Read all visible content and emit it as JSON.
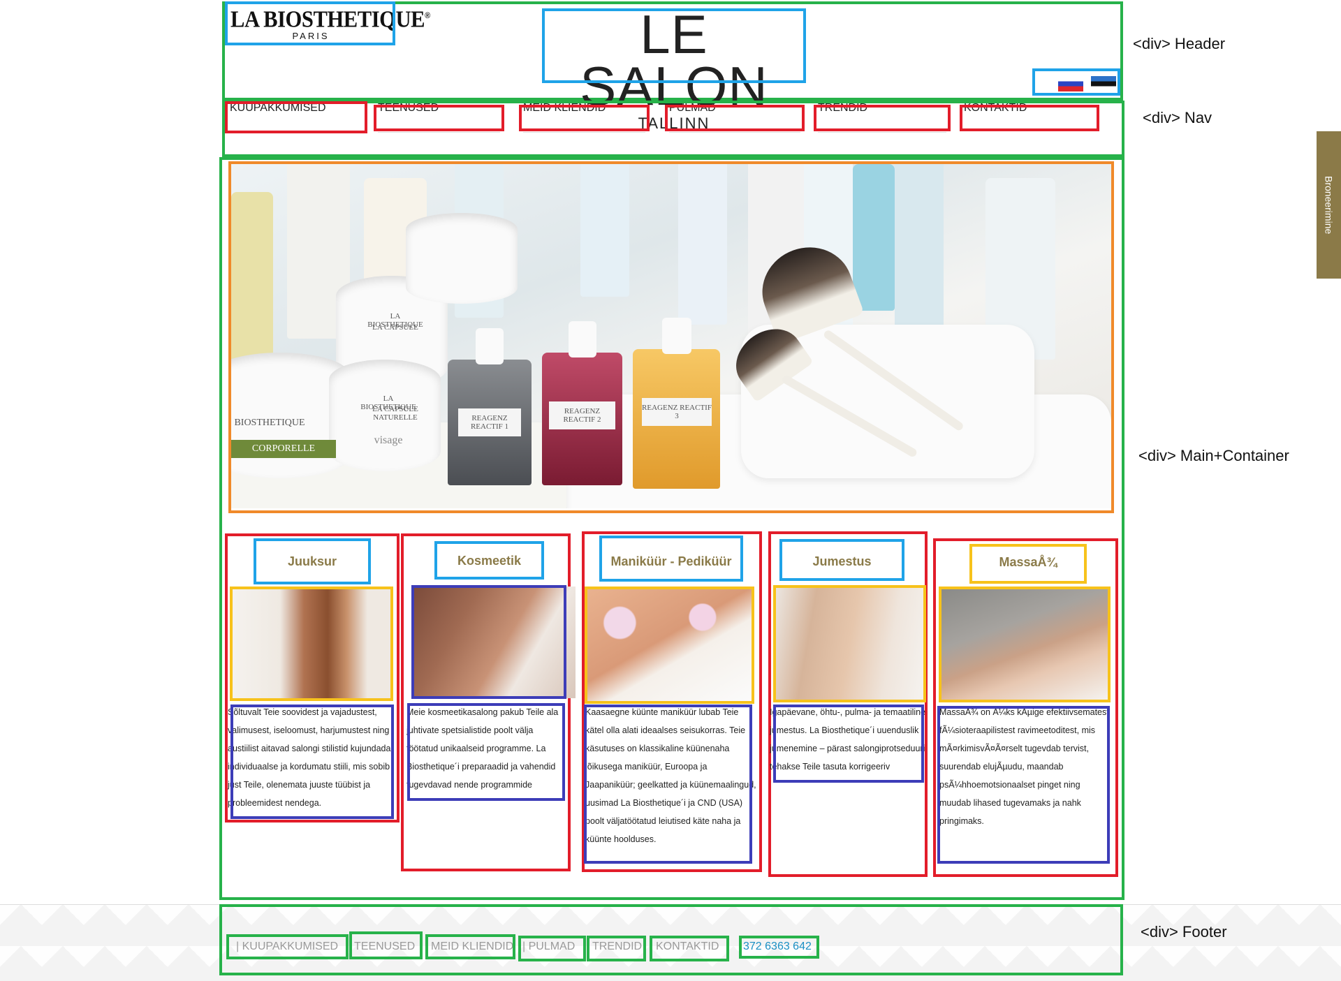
{
  "header": {
    "brand_logo": {
      "name": "LA BIOSTHETIQUE",
      "registered": "®",
      "city": "PARIS"
    },
    "salon_logo": {
      "title": "LE SALON",
      "city": "TALLINN"
    },
    "flags": [
      "russian-flag-icon",
      "estonian-flag-icon"
    ]
  },
  "nav": {
    "items": [
      "KUUPAKKUMISED",
      "TEENUSED",
      "MEID KLIENDID",
      "PULMAD",
      "TRENDID",
      "KONTAKTID"
    ]
  },
  "booking_tab": {
    "label": "Broneerimine"
  },
  "hero": {
    "jar_labels": [
      "LA BIOSTHETIQUE",
      "LA CAPSULE",
      "LA BIOSTHETIQUE",
      "LA CAPSULE NATURELLE",
      "visage",
      "BIOSTHETIQUE",
      "CORPORELLE"
    ],
    "bottle_labels": [
      "REAGENZ REACTIF 1",
      "REAGENZ REACTIF 2",
      "REAGENZ REACTIF 3"
    ]
  },
  "services": [
    {
      "title": "Juuksur",
      "text": "Sõltuvalt Teie soovidest ja vajadustest, valimusest, iseloomust, harjumustest ning austiilist aitavad salongi stilistid kujundada individuaalse ja kordumatu stiili, mis sobib just Teile, olenemata juuste tüübist ja probleemidest nendega."
    },
    {
      "title": "Kosmeetik",
      "text": "Meie kosmeetikasalong pakub Teile ala juhtivate spetsialistide poolt välja töötatud unikaalseid programme. La Biosthetique´i preparaadid ja vahendid tugevdavad nende programmide efektiivsust veelgi."
    },
    {
      "title": "Maniküür - Pediküür",
      "text": "Kaasaegne küünte maniküür lubab Teie kätel olla alati ideaalses seisukorras. Teie käsutuses on klassikaline küünenaha lõikusega maniküür, Euroopa ja Jaapaniküür; geelkatted ja küünemaalingud, uusimad La Biosthetique´i ja CND (USA) poolt väljatöötatud leiutised käte naha ja küünte hoolduses."
    },
    {
      "title": "Jumestus",
      "text": "Igapäevane, öhtu-, pulma- ja temaatiline jumestus. La Biosthetique´i uuenduslik jumenemine – pärast salongiprotseduuri tehakse Teile tasuta korrigeeriv jumestus."
    },
    {
      "title": "MassaÅ¾",
      "text": "MassaÅ¾ on Ã¼ks kÃµige efektiivsematest fÃ¼sioteraapilistest ravimeetoditest, mis mÃ¤rkimisvÃ¤Ã¤rselt tugevdab tervist, suurendab elujÃµudu, maandab psÃ¼hhoemotsionaalset pinget ning muudab lihased tugevamaks ja nahk pringimaks."
    }
  ],
  "footer": {
    "links": [
      "| KUUPAKKUMISED",
      "TEENUSED",
      "MEID KLIENDID",
      "| PULMAD",
      "TRENDID",
      "KONTAKTID"
    ],
    "phone": "372 6363 642"
  },
  "annotations": {
    "header": "<div> Header",
    "nav": "<div> Nav",
    "main": "<div> Main+Container",
    "footer": "<div> Footer"
  },
  "colors": {
    "accent_gold": "#8b7a48",
    "service_title": "#8a7a48",
    "link_gray": "#9a9a9a",
    "phone_blue": "#1a8fc4",
    "box_green": "#27b24a",
    "box_blue": "#1fa3e8",
    "box_red": "#e21d2a",
    "box_orange": "#f08a2a",
    "box_yellow": "#f7c21b",
    "box_purple": "#3d3db8"
  }
}
